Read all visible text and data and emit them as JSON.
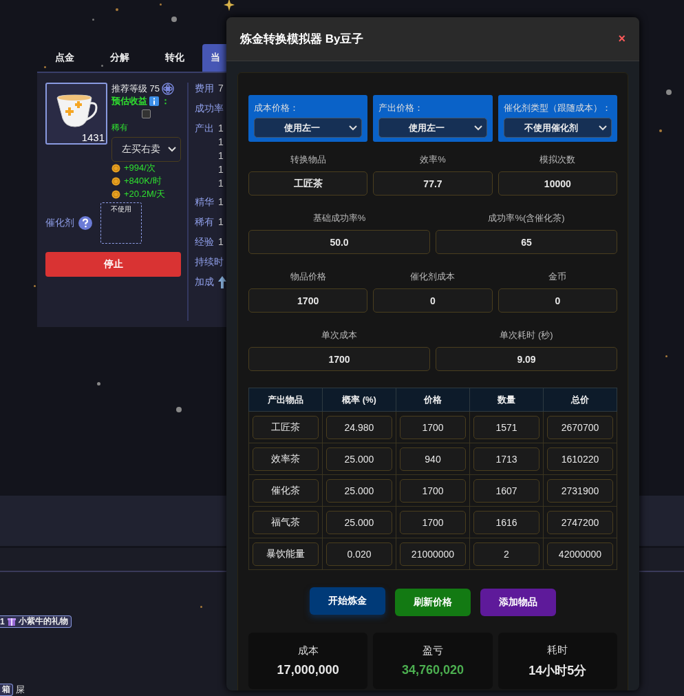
{
  "tabs": [
    {
      "label": "点金",
      "selected": false
    },
    {
      "label": "分解",
      "selected": false
    },
    {
      "label": "转化",
      "selected": false
    },
    {
      "label": "当",
      "selected": true
    }
  ],
  "item_panel": {
    "count": "1431",
    "recommended_level": "推荐等级 75",
    "estimated_profit_label": "预估收益",
    "colon": "：",
    "profit_checked": false,
    "rarity": "稀有",
    "mode_select": "左买右卖",
    "earnings": [
      "+994/次",
      "+840K/时",
      "+20.2M/天"
    ],
    "catalyst_label": "催化剂",
    "catalyst_slot": "不使用",
    "stop_button": "停止"
  },
  "stats_column": [
    {
      "label": "费用",
      "values": [
        "7"
      ]
    },
    {
      "label": "成功率"
    },
    {
      "label": "产出",
      "values": [
        "1",
        "1",
        "1",
        "1",
        "1"
      ]
    },
    {
      "label": "精华",
      "values": [
        "1"
      ]
    },
    {
      "label": "稀有",
      "values": [
        "1"
      ]
    },
    {
      "label": "经验",
      "values": [
        "1"
      ]
    },
    {
      "label": "持续时"
    },
    {
      "label": "加成",
      "kind": "arrow"
    }
  ],
  "inventory_tags": [
    {
      "kind": "gift",
      "count": "1",
      "name": "小紫牛的礼物"
    },
    {
      "kind": "chest",
      "name": "箱"
    },
    {
      "kind": "plain",
      "name": "屎"
    }
  ],
  "simulator": {
    "title": "炼金转换模拟器 By豆子",
    "close": "×",
    "selects": [
      {
        "label": "成本价格：",
        "value": "使用左一"
      },
      {
        "label": "产出价格：",
        "value": "使用左一"
      },
      {
        "label": "催化剂类型（跟随成本）：",
        "value": "不使用催化剂"
      }
    ],
    "field_rows": [
      [
        {
          "label": "转换物品",
          "value": "工匠茶"
        },
        {
          "label": "效率%",
          "value": "77.7"
        },
        {
          "label": "模拟次数",
          "value": "10000"
        }
      ],
      [
        {
          "label": "基础成功率%",
          "value": "50.0"
        },
        {
          "label": "成功率%(含催化茶)",
          "value": "65"
        }
      ],
      [
        {
          "label": "物品价格",
          "value": "1700"
        },
        {
          "label": "催化剂成本",
          "value": "0"
        },
        {
          "label": "金币",
          "value": "0"
        }
      ],
      [
        {
          "label": "单次成本",
          "value": "1700"
        },
        {
          "label": "单次耗时 (秒)",
          "value": "9.09"
        }
      ]
    ],
    "table": {
      "columns": [
        "产出物品",
        "概率 (%)",
        "价格",
        "数量",
        "总价"
      ],
      "rows": [
        [
          "工匠茶",
          "24.980",
          "1700",
          "1571",
          "2670700"
        ],
        [
          "效率茶",
          "25.000",
          "940",
          "1713",
          "1610220"
        ],
        [
          "催化茶",
          "25.000",
          "1700",
          "1607",
          "2731900"
        ],
        [
          "福气茶",
          "25.000",
          "1700",
          "1616",
          "2747200"
        ],
        [
          "暴饮能量",
          "0.020",
          "21000000",
          "2",
          "42000000"
        ]
      ]
    },
    "buttons": [
      {
        "label": "开始炼金",
        "color": "#003a78"
      },
      {
        "label": "刷新价格",
        "color": "#137a13"
      },
      {
        "label": "添加物品",
        "color": "#5e1a9a"
      }
    ],
    "summary": [
      {
        "label": "成本",
        "value": "17,000,000",
        "kind": "neutral"
      },
      {
        "label": "盈亏",
        "value": "34,760,020",
        "kind": "positive"
      },
      {
        "label": "耗时",
        "value": "14小时5分",
        "kind": "neutral"
      }
    ]
  }
}
